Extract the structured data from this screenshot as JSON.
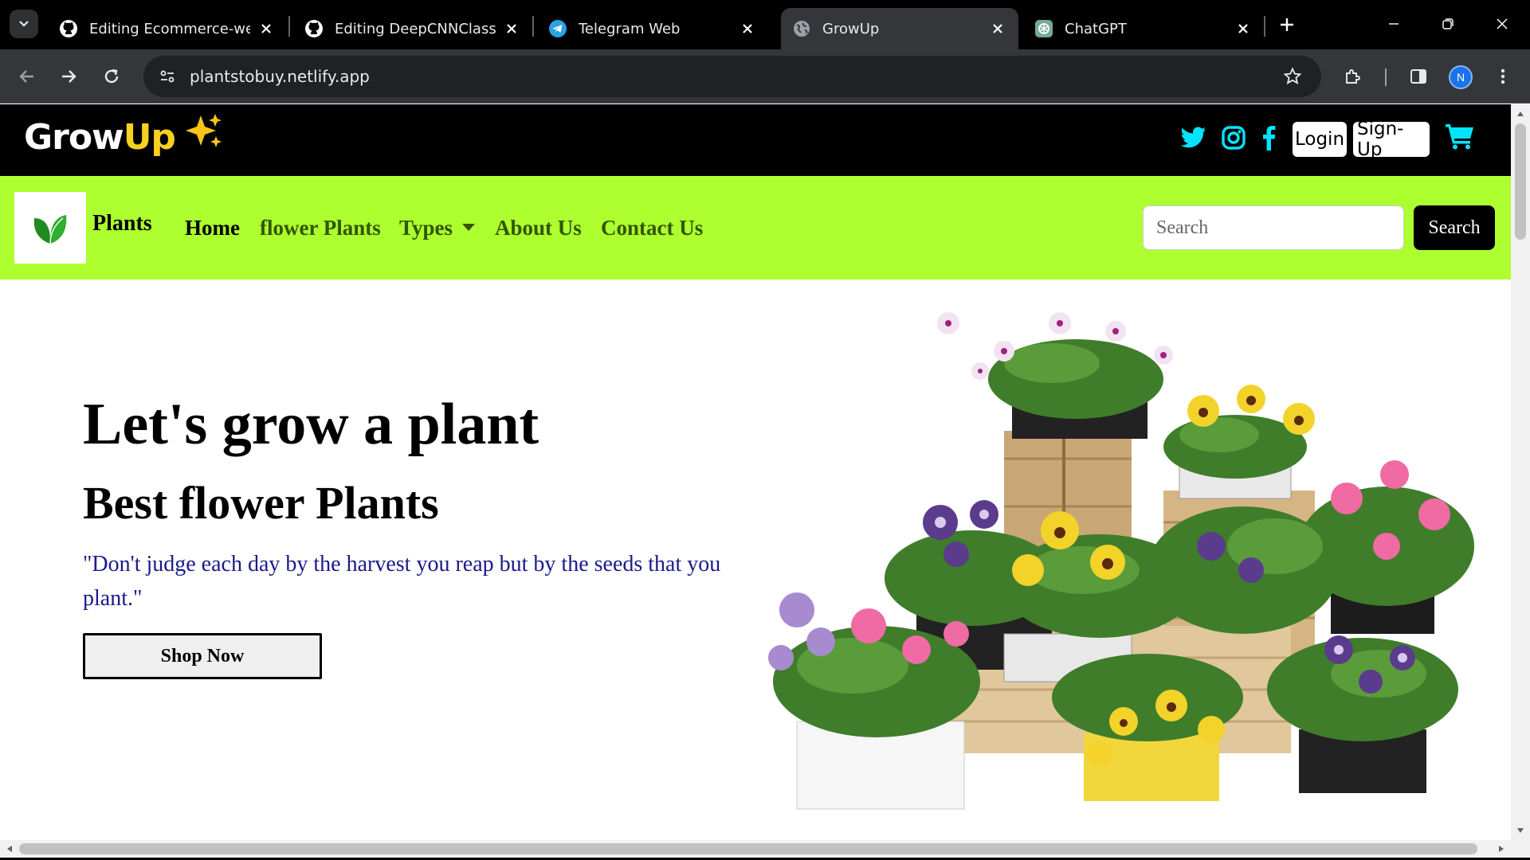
{
  "browser": {
    "tabs": [
      {
        "title": "Editing Ecommerce-website",
        "icon": "github-icon"
      },
      {
        "title": "Editing DeepCNNClassifier",
        "icon": "github-icon"
      },
      {
        "title": "Telegram Web",
        "icon": "telegram-icon"
      },
      {
        "title": "GrowUp",
        "icon": "globe-icon",
        "active": true
      },
      {
        "title": "ChatGPT",
        "icon": "chatgpt-icon"
      }
    ],
    "url": "plantstobuy.netlify.app",
    "profile_initial": "N",
    "accent": "#1a73e8"
  },
  "site": {
    "logo": {
      "part1": "Grow",
      "part2": "Up",
      "spark": "✨"
    },
    "header_buttons": {
      "login": "Login",
      "signup": "Sign-Up"
    },
    "social_icons": [
      "twitter-icon",
      "instagram-icon",
      "facebook-icon"
    ],
    "colors": {
      "header_bg": "#000000",
      "nav_bg": "#adff2f",
      "logo_accent": "#f7d11e",
      "social": "#00e5ff",
      "quote": "#1a1a8c"
    },
    "nav": {
      "brand": "Plants",
      "links": {
        "home": "Home",
        "flower": "flower Plants",
        "types": "Types",
        "about": "About Us",
        "contact": "Contact Us"
      },
      "search_placeholder": "Search",
      "search_button": "Search"
    },
    "hero": {
      "title": "Let's grow a plant",
      "subtitle": "Best flower Plants",
      "quote": "\"Don't judge each day by the harvest you reap but by the seeds that you plant.\"",
      "cta": "Shop Now"
    }
  }
}
